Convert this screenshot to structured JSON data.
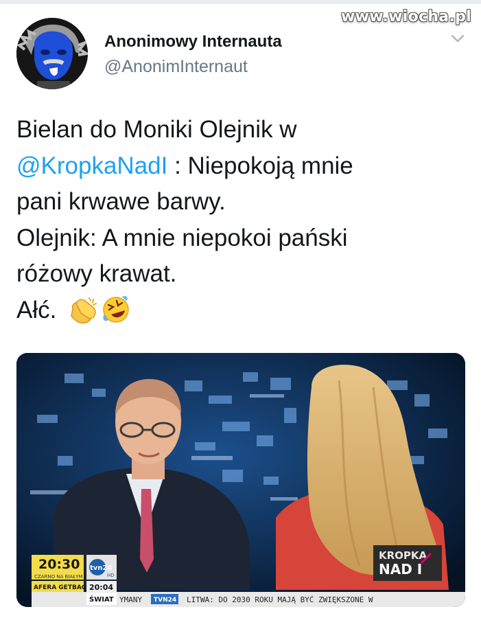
{
  "watermark": "www.wiocha.pl",
  "author": {
    "name": "Anonimowy Internauta",
    "handle": "@AnonimInternaut"
  },
  "icons": {
    "menu": "chevron-down-icon",
    "clap": "clapping-hands-emoji",
    "laugh": "rolling-laughing-emoji"
  },
  "tweet": {
    "line1": "Bielan do Moniki Olejnik w",
    "mention": "@KropkaNadI",
    "line2_rest": " : Niepokoją mnie",
    "line3": "pani krwawe barwy.",
    "line4": "Olejnik: A mnie niepokoi pański",
    "line5": "różowy krawat.",
    "line6": "Ałć."
  },
  "tv": {
    "clock": "20:30",
    "show_caption": "CZARNO NA BIAŁYM",
    "program": "AFERA GETBACK",
    "channel": "tvn24",
    "channel_hd": "HD",
    "channel_time": "20:04",
    "section": "ŚWIAT",
    "ticker_left": "YMANY",
    "ticker_channel": "TVN24",
    "ticker_news": "LITWA: DO 2030 ROKU MAJĄ BYĆ ZWIĘKSZONE W",
    "brand_line1": "KROPKA",
    "brand_line2": "NAD I"
  },
  "colors": {
    "mention": "#1da1f2",
    "text": "#14171a",
    "handle": "#657786",
    "clock_bg": "#f3dc4a",
    "ticker_bg": "#e9e9e9"
  }
}
